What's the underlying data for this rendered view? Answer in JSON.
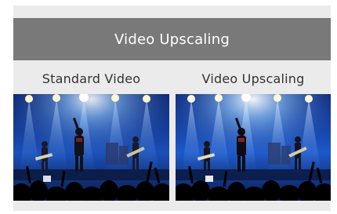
{
  "header": {
    "title": "Video Upscaling"
  },
  "comparison": {
    "left_label": "Standard Video",
    "right_label": "Video Upscaling"
  },
  "colors": {
    "panel_background": "#ebebeb",
    "header_background": "#797979",
    "header_text": "#ffffff",
    "label_text": "#333333"
  }
}
